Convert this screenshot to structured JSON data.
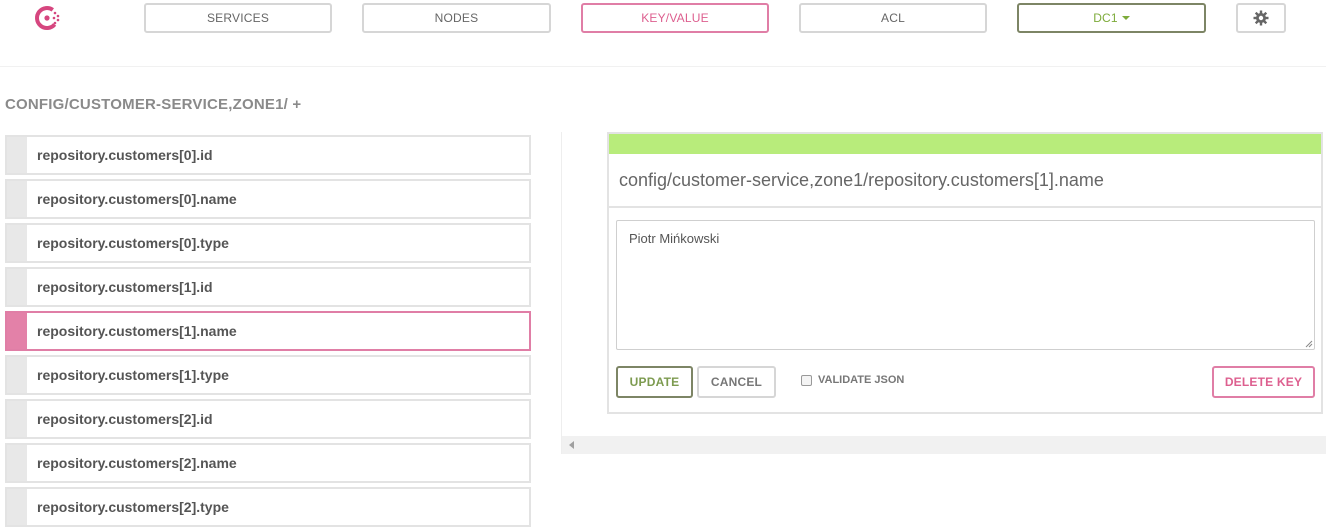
{
  "nav": {
    "services": "SERVICES",
    "nodes": "NODES",
    "keyvalue": "KEY/VALUE",
    "acl": "ACL",
    "datacenter": "DC1"
  },
  "colors": {
    "accent_pink": "#e07ea6",
    "accent_green": "#b8ec7b",
    "dc_green": "#7dab3a"
  },
  "icons": {
    "logo": "consul-logo",
    "settings": "gear-icon",
    "dropdown": "caret-down-icon"
  },
  "breadcrumb": {
    "path": "CONFIG/CUSTOMER-SERVICE,ZONE1/",
    "add": "+"
  },
  "keys": [
    {
      "label": "repository.customers[0].id",
      "selected": false
    },
    {
      "label": "repository.customers[0].name",
      "selected": false
    },
    {
      "label": "repository.customers[0].type",
      "selected": false
    },
    {
      "label": "repository.customers[1].id",
      "selected": false
    },
    {
      "label": "repository.customers[1].name",
      "selected": true
    },
    {
      "label": "repository.customers[1].type",
      "selected": false
    },
    {
      "label": "repository.customers[2].id",
      "selected": false
    },
    {
      "label": "repository.customers[2].name",
      "selected": false
    },
    {
      "label": "repository.customers[2].type",
      "selected": false
    }
  ],
  "editor": {
    "key": "config/customer-service,zone1/repository.customers[1].name",
    "value": "Piotr Mińkowski",
    "update": "UPDATE",
    "cancel": "CANCEL",
    "validate_json": "VALIDATE JSON",
    "delete": "DELETE KEY"
  }
}
